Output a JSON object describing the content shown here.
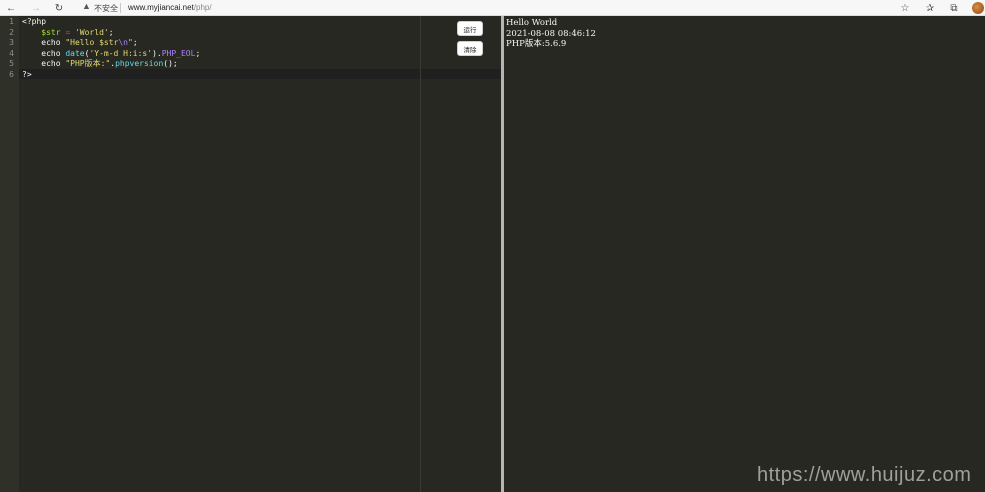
{
  "browser": {
    "security_label": "不安全",
    "url_host": "www.myjiancai.net",
    "url_path": "/php/",
    "icons": [
      "back-icon",
      "forward-icon",
      "reload-icon",
      "warning-icon",
      "favorite-add-icon",
      "favorites-icon",
      "collections-icon",
      "profile-avatar"
    ]
  },
  "editor": {
    "line_numbers": [
      "1",
      "2",
      "3",
      "4",
      "5",
      "6"
    ],
    "lines": [
      [
        {
          "t": "<?php",
          "c": "tok-tag"
        }
      ],
      [
        {
          "t": "    ",
          "c": ""
        },
        {
          "t": "$str",
          "c": "tok-var"
        },
        {
          "t": " = ",
          "c": "tok-op"
        },
        {
          "t": "'World'",
          "c": "tok-str"
        },
        {
          "t": ";",
          "c": ""
        }
      ],
      [
        {
          "t": "    ",
          "c": ""
        },
        {
          "t": "echo",
          "c": "tok-kw"
        },
        {
          "t": " ",
          "c": ""
        },
        {
          "t": "\"Hello $str",
          "c": "tok-str"
        },
        {
          "t": "\\n",
          "c": "tok-esc"
        },
        {
          "t": "\"",
          "c": "tok-str"
        },
        {
          "t": ";",
          "c": ""
        }
      ],
      [
        {
          "t": "    ",
          "c": ""
        },
        {
          "t": "echo",
          "c": "tok-kw"
        },
        {
          "t": " ",
          "c": ""
        },
        {
          "t": "date",
          "c": "tok-fn"
        },
        {
          "t": "(",
          "c": ""
        },
        {
          "t": "'Y-m-d H:i:s'",
          "c": "tok-str"
        },
        {
          "t": ").",
          "c": ""
        },
        {
          "t": "PHP_EOL",
          "c": "tok-const"
        },
        {
          "t": ";",
          "c": ""
        }
      ],
      [
        {
          "t": "    ",
          "c": ""
        },
        {
          "t": "echo",
          "c": "tok-kw"
        },
        {
          "t": " ",
          "c": ""
        },
        {
          "t": "\"PHP版本:\"",
          "c": "tok-str"
        },
        {
          "t": ".",
          "c": ""
        },
        {
          "t": "phpversion",
          "c": "tok-fn"
        },
        {
          "t": "();",
          "c": ""
        }
      ],
      [
        {
          "t": "?>",
          "c": "tok-tag"
        }
      ]
    ],
    "run_label": "运行",
    "clear_label": "清除"
  },
  "output": {
    "lines": [
      "Hello World",
      "2021-08-08 08:46:12",
      "PHP版本:5.6.9"
    ]
  },
  "watermark": "https://www.huijuz.com"
}
